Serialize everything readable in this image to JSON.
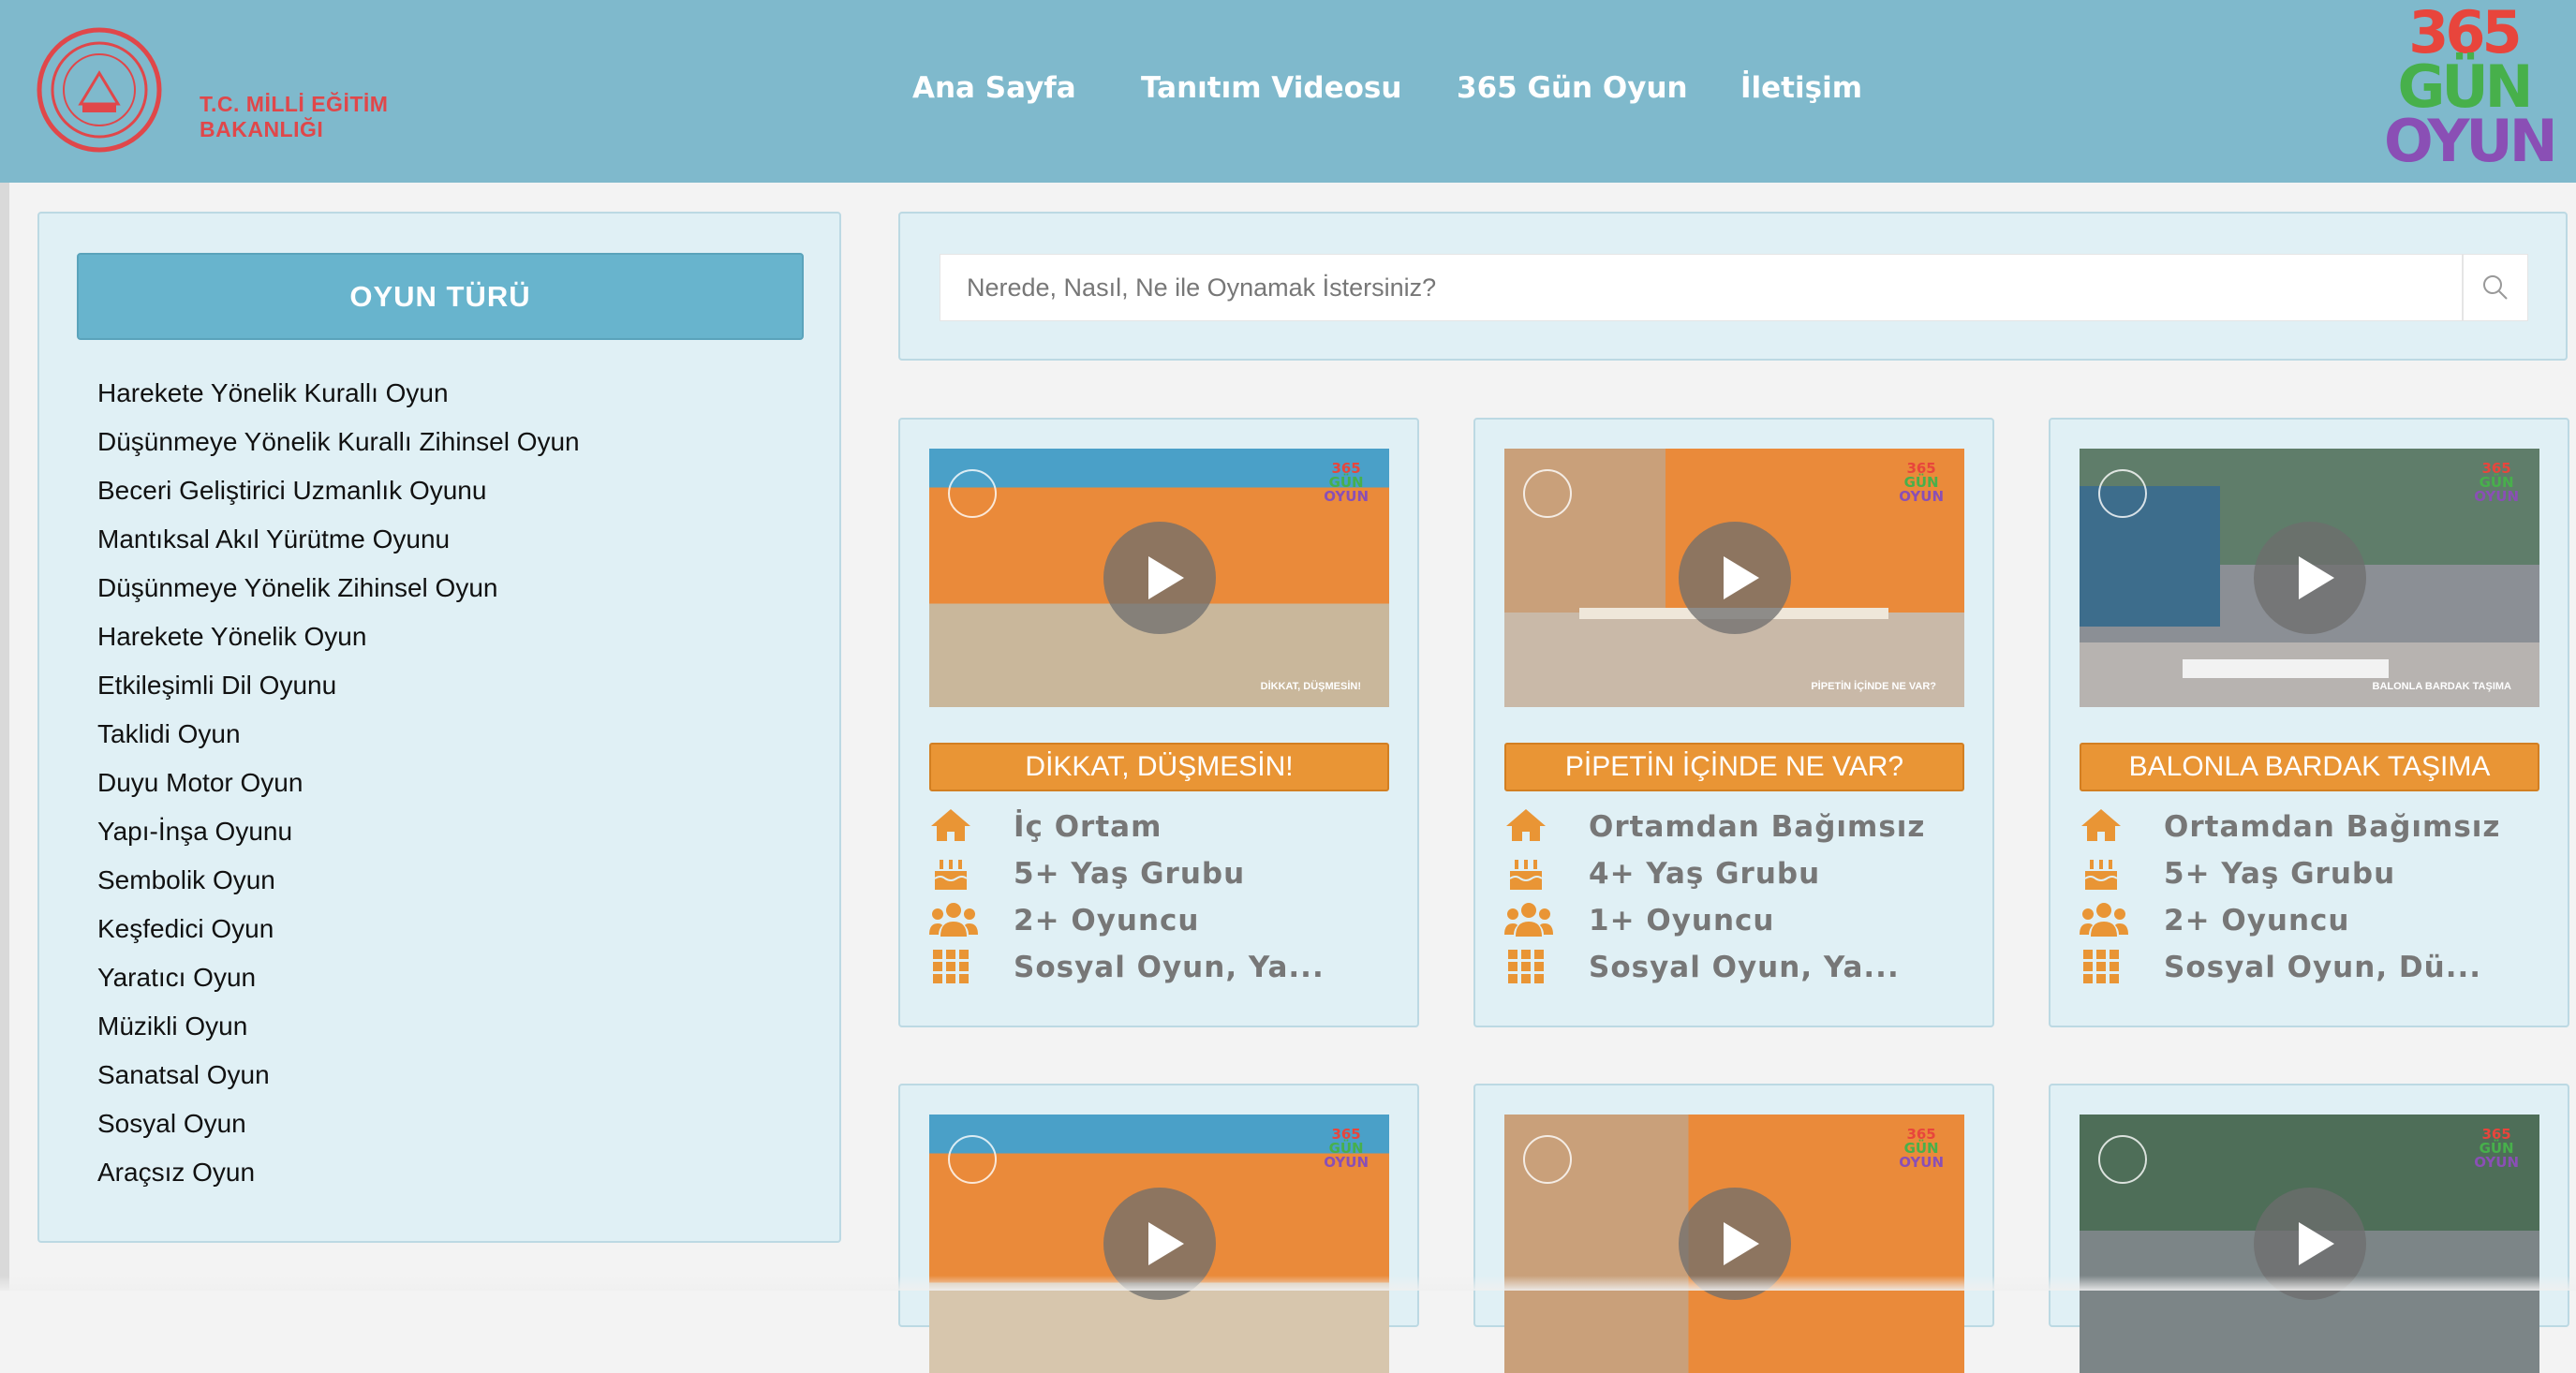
{
  "header": {
    "ministry_line1": "T.C. MİLLİ EĞİTİM",
    "ministry_line2": "BAKANLIĞI",
    "nav": [
      "Ana Sayfa",
      "Tanıtım Videosu",
      "365 Gün Oyun",
      "İletişim"
    ],
    "brand": {
      "line1": "365",
      "line2": "GÜN",
      "line3": "OYUN"
    }
  },
  "sidebar": {
    "title": "OYUN TÜRÜ",
    "items": [
      "Harekete Yönelik Kurallı Oyun",
      "Düşünmeye Yönelik Kurallı Zihinsel Oyun",
      "Beceri Geliştirici Uzmanlık Oyunu",
      "Mantıksal Akıl Yürütme Oyunu",
      "Düşünmeye Yönelik Zihinsel Oyun",
      "Harekete Yönelik Oyun",
      "Etkileşimli Dil Oyunu",
      "Taklidi Oyun",
      "Duyu Motor Oyun",
      "Yapı-İnşa Oyunu",
      "Sembolik Oyun",
      "Keşfedici Oyun",
      "Yaratıcı Oyun",
      "Müzikli Oyun",
      "Sanatsal Oyun",
      "Sosyal Oyun",
      "Araçsız Oyun"
    ]
  },
  "search": {
    "placeholder": "Nerede, Nasıl, Ne ile Oynamak İstersiniz?"
  },
  "cards": [
    {
      "title": "DİKKAT, DÜŞMESİN!",
      "video_caption": "DİKKAT, DÜŞMESİN!",
      "place": "İç Ortam",
      "age": "5+ Yaş Grubu",
      "players": "2+ Oyuncu",
      "type": "Sosyal Oyun, Ya..."
    },
    {
      "title": "PİPETİN İÇİNDE NE VAR?",
      "video_caption": "PİPETİN İÇİNDE NE VAR?",
      "place": "Ortamdan Bağımsız",
      "age": "4+ Yaş Grubu",
      "players": "1+ Oyuncu",
      "type": "Sosyal Oyun, Ya..."
    },
    {
      "title": "BALONLA BARDAK TAŞIMA",
      "video_caption": "BALONLA BARDAK TAŞIMA",
      "place": "Ortamdan Bağımsız",
      "age": "5+ Yaş Grubu",
      "players": "2+ Oyuncu",
      "type": "Sosyal Oyun, Dü..."
    },
    {},
    {},
    {}
  ],
  "colors": {
    "header_bg": "#7fb9cc",
    "panel_bg": "#e0f0f5",
    "accent_orange": "#e99535",
    "sidebar_header": "#68b4cd",
    "ministry_red": "#e0474a"
  },
  "icons": {
    "place": "home-icon",
    "age": "birthday-cake-icon",
    "players": "users-icon",
    "type": "grid-icon"
  }
}
